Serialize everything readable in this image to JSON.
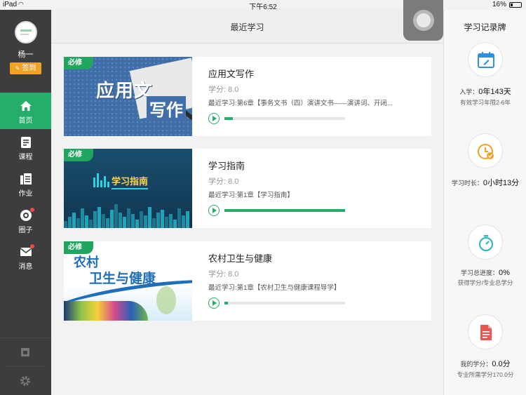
{
  "status_bar": {
    "carrier": "iPad",
    "time": "下午6:52",
    "battery": "16%"
  },
  "header": {
    "title": "最近学习"
  },
  "sidebar": {
    "username": "杨一",
    "checkin_label": "签到",
    "items": [
      {
        "label": "首页",
        "icon": "home-icon",
        "active": true
      },
      {
        "label": "课程",
        "icon": "course-icon",
        "active": false
      },
      {
        "label": "作业",
        "icon": "homework-icon",
        "active": false
      },
      {
        "label": "圈子",
        "icon": "circle-icon",
        "active": false,
        "badge": true
      },
      {
        "label": "消息",
        "icon": "message-icon",
        "active": false,
        "badge": true
      }
    ]
  },
  "courses": [
    {
      "tag": "必修",
      "title": "应用文写作",
      "credit": "学分: 8.0",
      "recent": "最近学习:第6章【事务文书（四）演讲文书——演讲词、开闭...",
      "progress": 0.07,
      "thumb_text": [
        "应用文",
        "写作"
      ]
    },
    {
      "tag": "必修",
      "title": "学习指南",
      "credit": "学分: 8.0",
      "recent": "最近学习:第1章【学习指南】",
      "progress": 1.0,
      "thumb_text": [
        "学习指南"
      ]
    },
    {
      "tag": "必修",
      "title": "农村卫生与健康",
      "credit": "学分: 8.0",
      "recent": "最近学习:第1章【农村卫生与健康课程导学】",
      "progress": 0.03,
      "thumb_text": [
        "农村",
        "卫生与健康"
      ]
    }
  ],
  "record_panel": {
    "title": "学习记录牌",
    "stats": [
      {
        "icon": "calendar-icon",
        "label": "入学：",
        "value": "0年143天",
        "sub": "有效学习年限2-6年",
        "color": "#2f8fd8"
      },
      {
        "icon": "clock-icon",
        "label": "学习时长：",
        "value": "0小时13分",
        "sub": "",
        "color": "#f0a221"
      },
      {
        "icon": "stopwatch-icon",
        "label": "学习总进度：",
        "value": "0%",
        "sub": "获得学分/专业总学分",
        "color": "#2cb3b8"
      },
      {
        "icon": "document-icon",
        "label": "我的学分：",
        "value": "0.0分",
        "sub": "专业所需学分170.0分",
        "color": "#e8574d"
      }
    ]
  }
}
